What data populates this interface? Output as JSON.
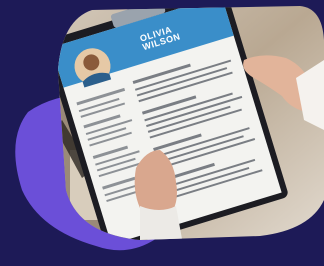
{
  "image": {
    "subject": "hands-holding-resume-clipboard",
    "background_color": "#1d1a57",
    "accent_blob_color": "#6b4fd8",
    "resume": {
      "first_name": "OLIVIA",
      "last_name": "WILSON",
      "header_color": "#3a8ec9"
    }
  }
}
